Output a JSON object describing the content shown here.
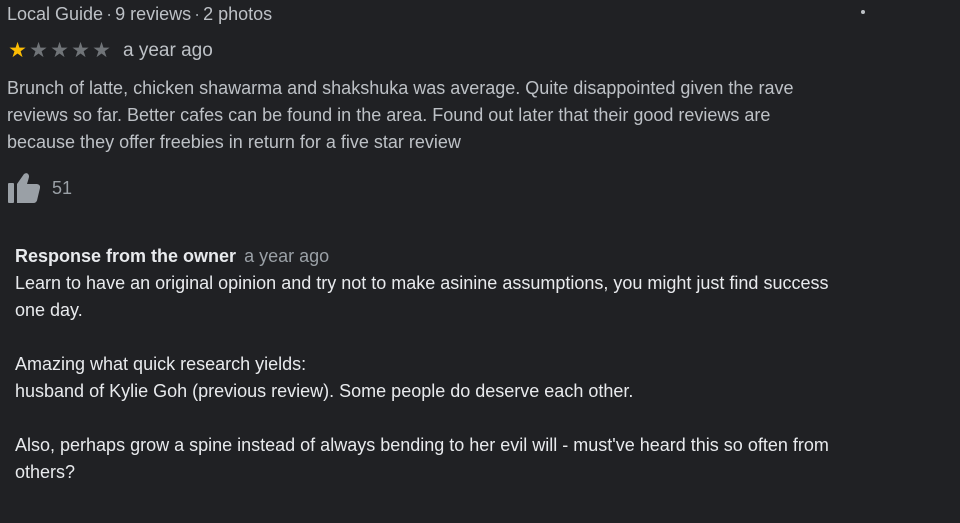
{
  "reviewer": {
    "badge": "Local Guide",
    "reviews": "9 reviews",
    "photos": "2 photos",
    "separator": "·"
  },
  "menu": {
    "icon": "more-vert-icon"
  },
  "review": {
    "rating": 1,
    "max_rating": 5,
    "date": "a year ago",
    "star_color": "#fbbc04",
    "text": "Brunch of latte, chicken shawarma and shakshuka was average. Quite disappointed given the rave\nreviews so far. Better cafes can be found in the area. Found out later that their good reviews are\nbecause they offer freebies in return for a five star review"
  },
  "likes": {
    "icon": "thumbs-up-icon",
    "count": "51"
  },
  "owner_response": {
    "title": "Response from the owner",
    "date": "a year ago",
    "text": "Learn to have an original opinion and try not to make asinine assumptions, you might just find success\none day.\n\nAmazing what quick research yields:\nhusband of Kylie Goh (previous review). Some people do deserve each other.\n\nAlso, perhaps grow a spine instead of always bending to her evil will - must've heard this so often from\nothers?"
  }
}
